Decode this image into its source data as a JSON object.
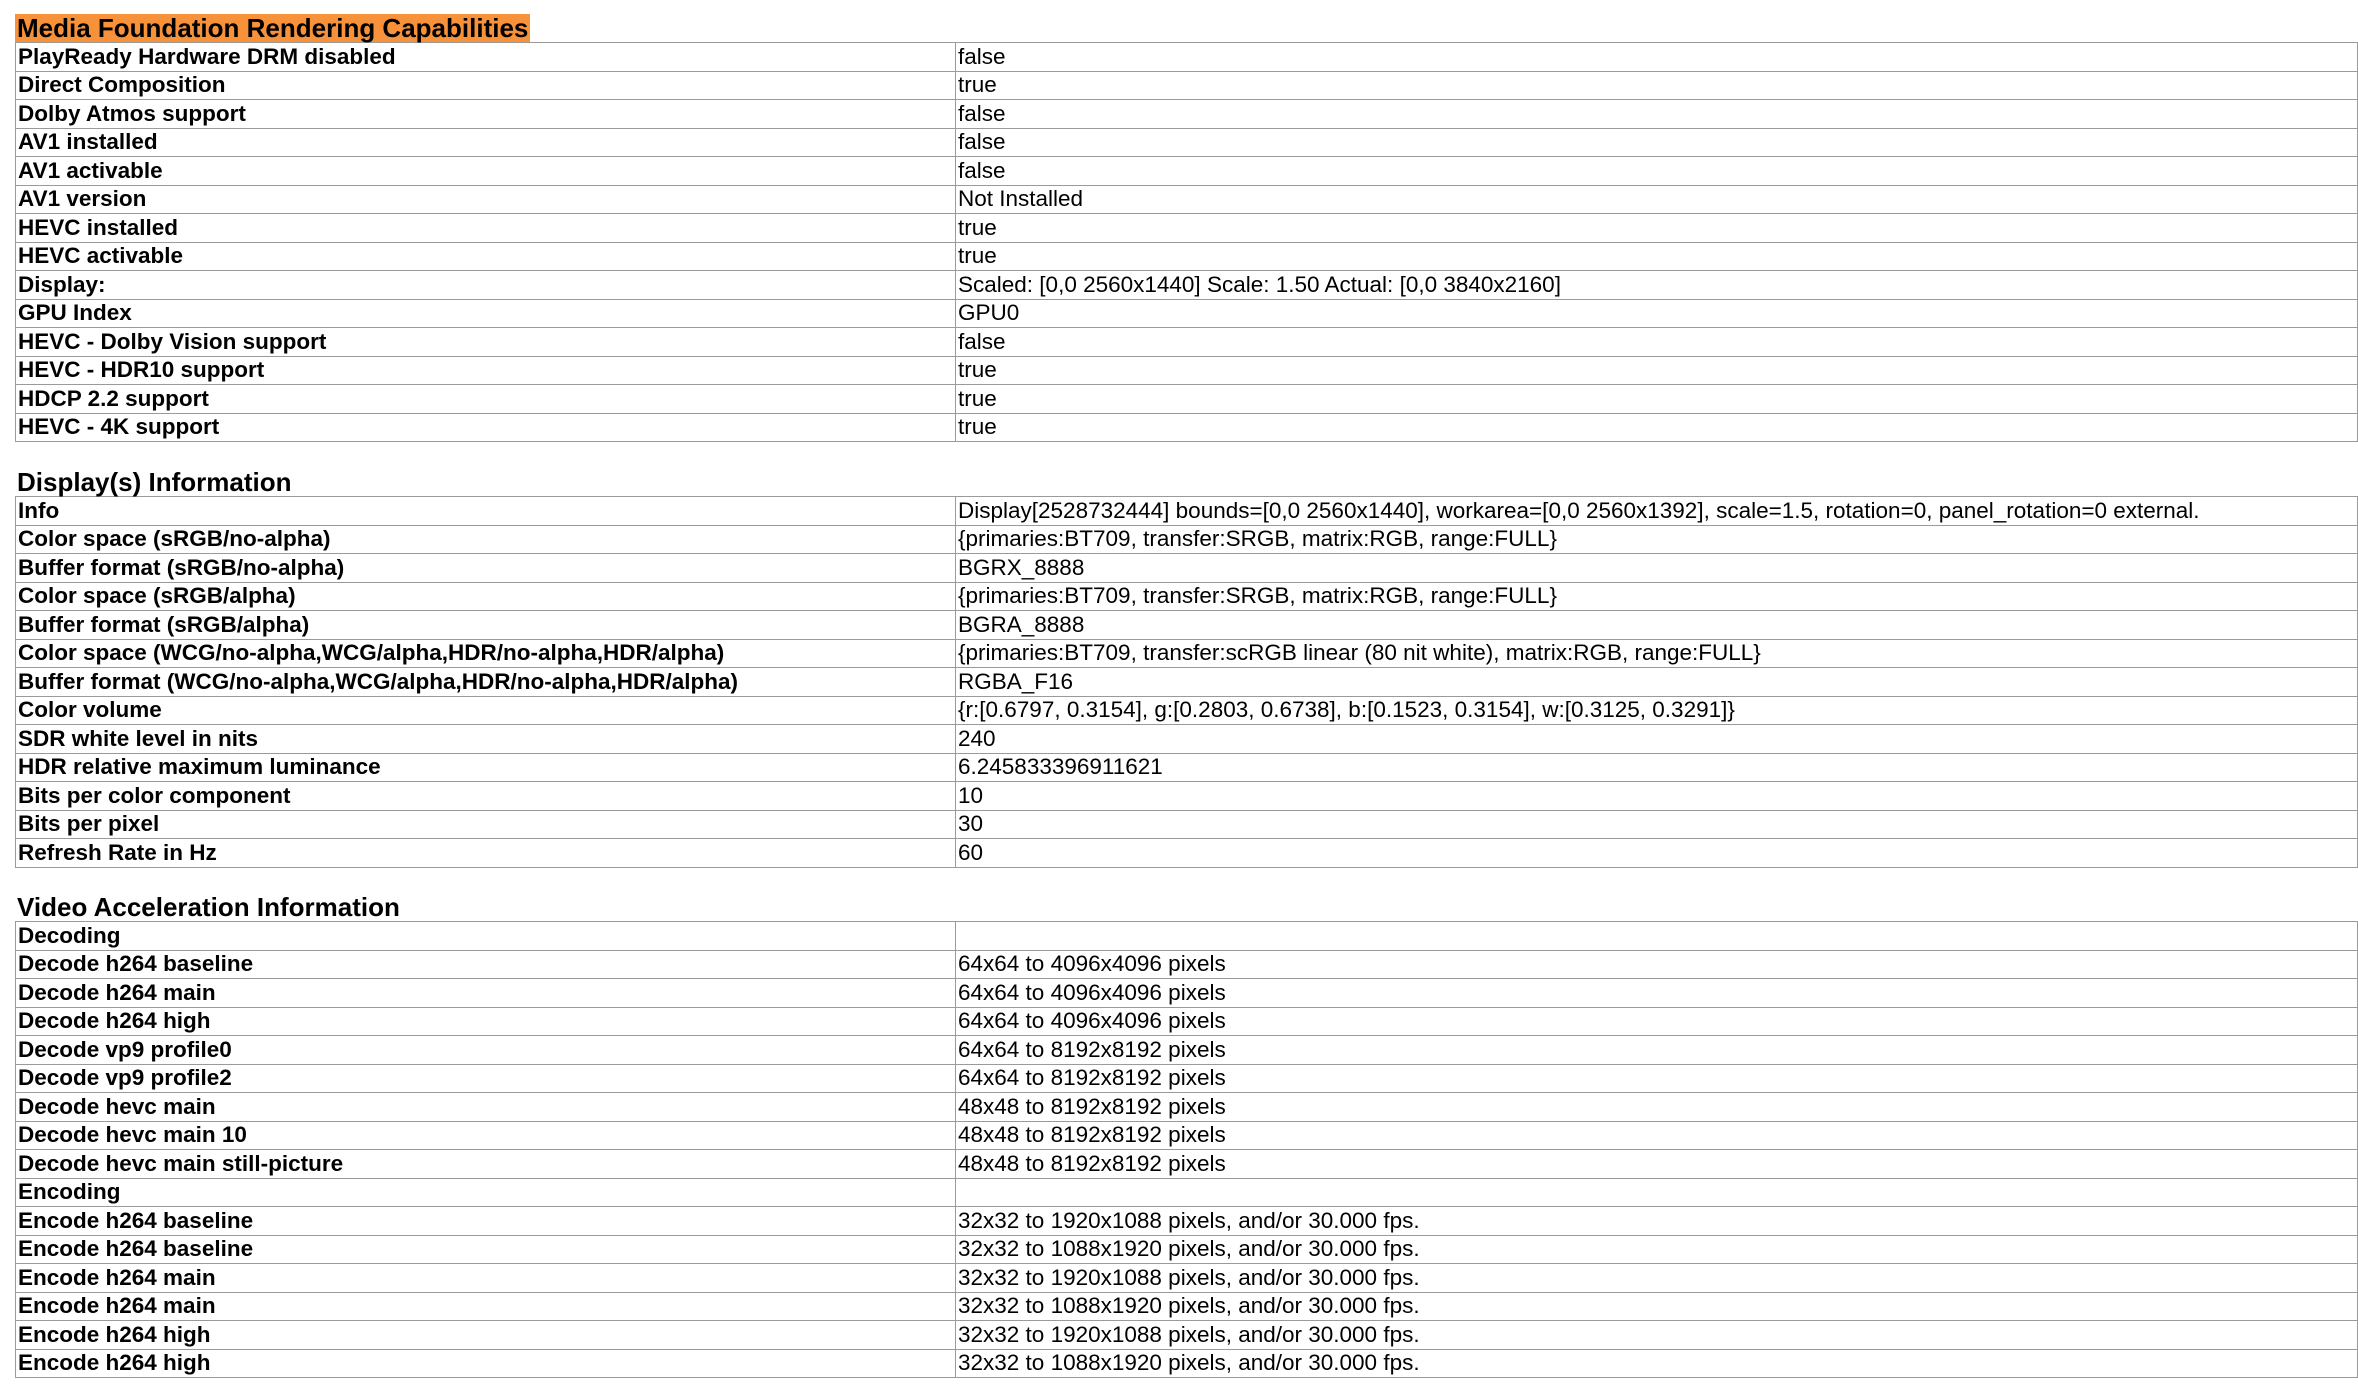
{
  "sections": [
    {
      "title": "Media Foundation Rendering Capabilities",
      "highlight": true,
      "rows": [
        {
          "k": "PlayReady Hardware DRM disabled",
          "v": "false"
        },
        {
          "k": "Direct Composition",
          "v": "true"
        },
        {
          "k": "Dolby Atmos support",
          "v": "false"
        },
        {
          "k": "AV1 installed",
          "v": "false"
        },
        {
          "k": "AV1 activable",
          "v": "false"
        },
        {
          "k": "AV1 version",
          "v": "Not Installed"
        },
        {
          "k": "HEVC installed",
          "v": "true"
        },
        {
          "k": "HEVC activable",
          "v": "true"
        },
        {
          "k": "Display:",
          "v": "Scaled: [0,0 2560x1440] Scale: 1.50 Actual: [0,0 3840x2160]"
        },
        {
          "k": "GPU Index",
          "v": "GPU0"
        },
        {
          "k": "HEVC - Dolby Vision support",
          "v": "false"
        },
        {
          "k": "HEVC - HDR10 support",
          "v": "true"
        },
        {
          "k": "HDCP 2.2 support",
          "v": "true"
        },
        {
          "k": "HEVC - 4K support",
          "v": "true"
        }
      ]
    },
    {
      "title": "Display(s) Information",
      "highlight": false,
      "rows": [
        {
          "k": "Info",
          "v": "Display[2528732444] bounds=[0,0 2560x1440], workarea=[0,0 2560x1392], scale=1.5, rotation=0, panel_rotation=0 external."
        },
        {
          "k": "Color space (sRGB/no-alpha)",
          "v": "{primaries:BT709, transfer:SRGB, matrix:RGB, range:FULL}"
        },
        {
          "k": "Buffer format (sRGB/no-alpha)",
          "v": "BGRX_8888"
        },
        {
          "k": "Color space (sRGB/alpha)",
          "v": "{primaries:BT709, transfer:SRGB, matrix:RGB, range:FULL}"
        },
        {
          "k": "Buffer format (sRGB/alpha)",
          "v": "BGRA_8888"
        },
        {
          "k": "Color space (WCG/no-alpha,WCG/alpha,HDR/no-alpha,HDR/alpha)",
          "v": "{primaries:BT709, transfer:scRGB linear (80 nit white), matrix:RGB, range:FULL}"
        },
        {
          "k": "Buffer format (WCG/no-alpha,WCG/alpha,HDR/no-alpha,HDR/alpha)",
          "v": "RGBA_F16"
        },
        {
          "k": "Color volume",
          "v": "{r:[0.6797, 0.3154], g:[0.2803, 0.6738], b:[0.1523, 0.3154], w:[0.3125, 0.3291]}"
        },
        {
          "k": "SDR white level in nits",
          "v": "240"
        },
        {
          "k": "HDR relative maximum luminance",
          "v": "6.245833396911621"
        },
        {
          "k": "Bits per color component",
          "v": "10"
        },
        {
          "k": "Bits per pixel",
          "v": "30"
        },
        {
          "k": "Refresh Rate in Hz",
          "v": "60"
        }
      ]
    },
    {
      "title": "Video Acceleration Information",
      "highlight": false,
      "rows": [
        {
          "k": "Decoding",
          "v": ""
        },
        {
          "k": "Decode h264 baseline",
          "v": "64x64 to 4096x4096 pixels"
        },
        {
          "k": "Decode h264 main",
          "v": "64x64 to 4096x4096 pixels"
        },
        {
          "k": "Decode h264 high",
          "v": "64x64 to 4096x4096 pixels"
        },
        {
          "k": "Decode vp9 profile0",
          "v": "64x64 to 8192x8192 pixels"
        },
        {
          "k": "Decode vp9 profile2",
          "v": "64x64 to 8192x8192 pixels"
        },
        {
          "k": "Decode hevc main",
          "v": "48x48 to 8192x8192 pixels"
        },
        {
          "k": "Decode hevc main 10",
          "v": "48x48 to 8192x8192 pixels"
        },
        {
          "k": "Decode hevc main still-picture",
          "v": "48x48 to 8192x8192 pixels"
        },
        {
          "k": "Encoding",
          "v": ""
        },
        {
          "k": "Encode h264 baseline",
          "v": "32x32 to 1920x1088 pixels, and/or 30.000 fps."
        },
        {
          "k": "Encode h264 baseline",
          "v": "32x32 to 1088x1920 pixels, and/or 30.000 fps."
        },
        {
          "k": "Encode h264 main",
          "v": "32x32 to 1920x1088 pixels, and/or 30.000 fps."
        },
        {
          "k": "Encode h264 main",
          "v": "32x32 to 1088x1920 pixels, and/or 30.000 fps."
        },
        {
          "k": "Encode h264 high",
          "v": "32x32 to 1920x1088 pixels, and/or 30.000 fps."
        },
        {
          "k": "Encode h264 high",
          "v": "32x32 to 1088x1920 pixels, and/or 30.000 fps."
        }
      ]
    }
  ],
  "colors": {
    "highlight": "#f7913a",
    "border": "#9a9a9a"
  }
}
